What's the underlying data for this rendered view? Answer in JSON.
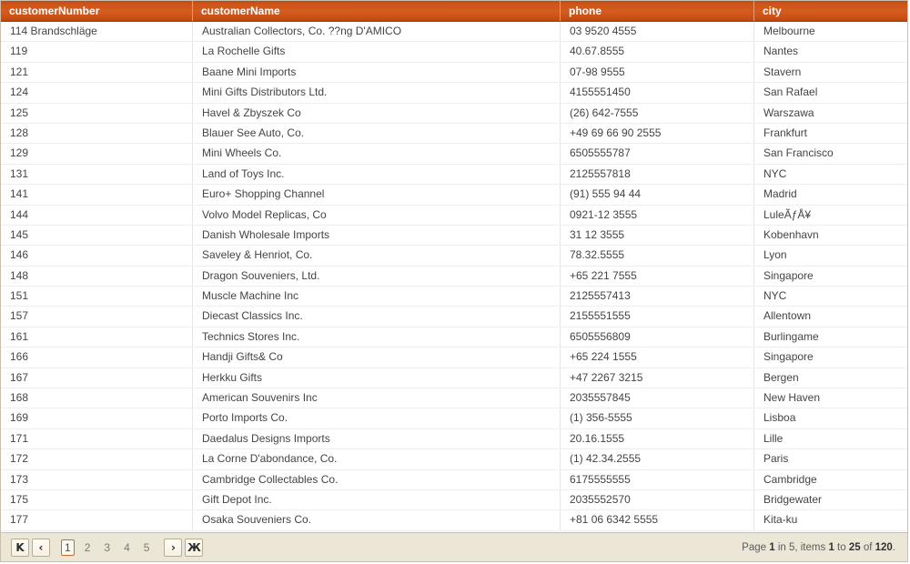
{
  "grid": {
    "columns": [
      {
        "key": "customerNumber",
        "label": "customerNumber"
      },
      {
        "key": "customerName",
        "label": "customerName"
      },
      {
        "key": "phone",
        "label": "phone"
      },
      {
        "key": "city",
        "label": "city"
      }
    ],
    "rows": [
      {
        "customerNumber": "114 Brandschläge",
        "customerName": "Australian Collectors, Co. ??ng D'AMICO",
        "phone": "03 9520 4555",
        "city": "Melbourne"
      },
      {
        "customerNumber": "119",
        "customerName": "La Rochelle Gifts",
        "phone": "40.67.8555",
        "city": "Nantes"
      },
      {
        "customerNumber": "121",
        "customerName": "Baane Mini Imports",
        "phone": "07-98 9555",
        "city": "Stavern"
      },
      {
        "customerNumber": "124",
        "customerName": "Mini Gifts Distributors Ltd.",
        "phone": "4155551450",
        "city": "San Rafael"
      },
      {
        "customerNumber": "125",
        "customerName": "Havel & Zbyszek Co",
        "phone": "(26) 642-7555",
        "city": "Warszawa"
      },
      {
        "customerNumber": "128",
        "customerName": "Blauer See Auto, Co.",
        "phone": "+49 69 66 90 2555",
        "city": "Frankfurt"
      },
      {
        "customerNumber": "129",
        "customerName": "Mini Wheels Co.",
        "phone": "6505555787",
        "city": "San Francisco"
      },
      {
        "customerNumber": "131",
        "customerName": "Land of Toys Inc.",
        "phone": "2125557818",
        "city": "NYC"
      },
      {
        "customerNumber": "141",
        "customerName": "Euro+ Shopping Channel",
        "phone": "(91) 555 94 44",
        "city": "Madrid"
      },
      {
        "customerNumber": "144",
        "customerName": "Volvo Model Replicas, Co",
        "phone": "0921-12 3555",
        "city": "LuleÃƒÅ¥"
      },
      {
        "customerNumber": "145",
        "customerName": "Danish Wholesale Imports",
        "phone": "31 12 3555",
        "city": "Kobenhavn"
      },
      {
        "customerNumber": "146",
        "customerName": "Saveley & Henriot, Co.",
        "phone": "78.32.5555",
        "city": "Lyon"
      },
      {
        "customerNumber": "148",
        "customerName": "Dragon Souveniers, Ltd.",
        "phone": "+65 221 7555",
        "city": "Singapore"
      },
      {
        "customerNumber": "151",
        "customerName": "Muscle Machine Inc",
        "phone": "2125557413",
        "city": "NYC"
      },
      {
        "customerNumber": "157",
        "customerName": "Diecast Classics Inc.",
        "phone": "2155551555",
        "city": "Allentown"
      },
      {
        "customerNumber": "161",
        "customerName": "Technics Stores Inc.",
        "phone": "6505556809",
        "city": "Burlingame"
      },
      {
        "customerNumber": "166",
        "customerName": "Handji Gifts& Co",
        "phone": "+65 224 1555",
        "city": "Singapore"
      },
      {
        "customerNumber": "167",
        "customerName": "Herkku Gifts",
        "phone": "+47 2267 3215",
        "city": "Bergen"
      },
      {
        "customerNumber": "168",
        "customerName": "American Souvenirs Inc",
        "phone": "2035557845",
        "city": "New Haven"
      },
      {
        "customerNumber": "169",
        "customerName": "Porto Imports Co.",
        "phone": "(1) 356-5555",
        "city": "Lisboa"
      },
      {
        "customerNumber": "171",
        "customerName": "Daedalus Designs Imports",
        "phone": "20.16.1555",
        "city": "Lille"
      },
      {
        "customerNumber": "172",
        "customerName": "La Corne D'abondance, Co.",
        "phone": "(1) 42.34.2555",
        "city": "Paris"
      },
      {
        "customerNumber": "173",
        "customerName": "Cambridge Collectables Co.",
        "phone": "6175555555",
        "city": "Cambridge"
      },
      {
        "customerNumber": "175",
        "customerName": "Gift Depot Inc.",
        "phone": "2035552570",
        "city": "Bridgewater"
      },
      {
        "customerNumber": "177",
        "customerName": "Osaka Souveniers Co.",
        "phone": "+81 06 6342 5555",
        "city": "Kita-ku"
      }
    ]
  },
  "pager": {
    "first_label": "K",
    "prev_label": "‹",
    "next_label": "›",
    "last_label": "Ж",
    "pages": [
      "1",
      "2",
      "3",
      "4",
      "5"
    ],
    "active_page": "1",
    "status": {
      "prefix": "Page ",
      "current_page": "1",
      "mid1": " in 5, items ",
      "from": "1",
      "mid2": " to ",
      "to": "25",
      "mid3": " of ",
      "total": "120",
      "suffix": "."
    }
  },
  "theme": {
    "header_accent": "#cf5519",
    "footer_bg": "#ece6d6",
    "active_page_border": "#cc6a2c"
  }
}
